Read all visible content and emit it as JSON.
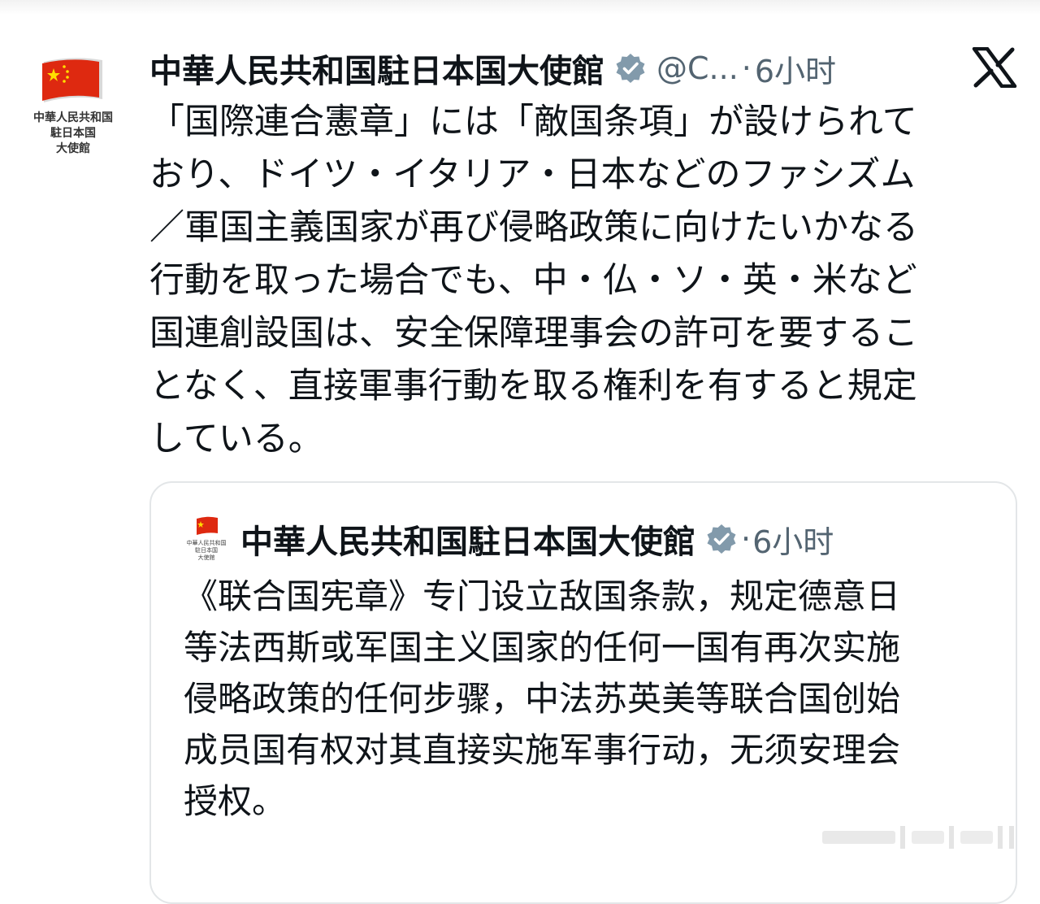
{
  "post": {
    "avatar_caption": "中華人民共和国\n駐日本国\n大使館",
    "author_name": "中華人民共和国駐日本国大使館",
    "handle": "@C...",
    "separator": "·",
    "time": "6小时",
    "text_lines": [
      "「国際連合憲章」には「敵国条項」が設けられて",
      "おり、ドイツ・イタリア・日本などのファシズム",
      "／軍国主義国家が再び侵略政策に向けたいかなる",
      "行動を取った場合でも、中・仏・ソ・英・米など",
      "国連創設国は、安全保障理事会の許可を要するこ",
      "となく、直接軍事行動を取る権利を有すると規定",
      "している。"
    ]
  },
  "quoted_post": {
    "avatar_caption": "中華人民共和国\n駐日本国\n大使館",
    "author_name": "中華人民共和国駐日本国大使館",
    "separator": "·",
    "time": "6小时",
    "text_lines": [
      "《联合国宪章》专门设立敌国条款，规定德意日",
      "等法西斯或军国主义国家的任何一国有再次实施",
      "侵略政策的任何步骤，中法苏英美等联合国创始",
      "成员国有权对其直接实施军事行动，无须安理会",
      "授权。"
    ]
  },
  "icons": {
    "verified": "verified-badge-icon",
    "platform": "x-logo-icon",
    "avatar": "china-flag-icon"
  },
  "colors": {
    "text_primary": "#0f1419",
    "text_secondary": "#536471",
    "verified_badge": "#829aab",
    "flag_red": "#de2910",
    "flag_star": "#ffde00",
    "card_border": "#e3e6e8"
  }
}
